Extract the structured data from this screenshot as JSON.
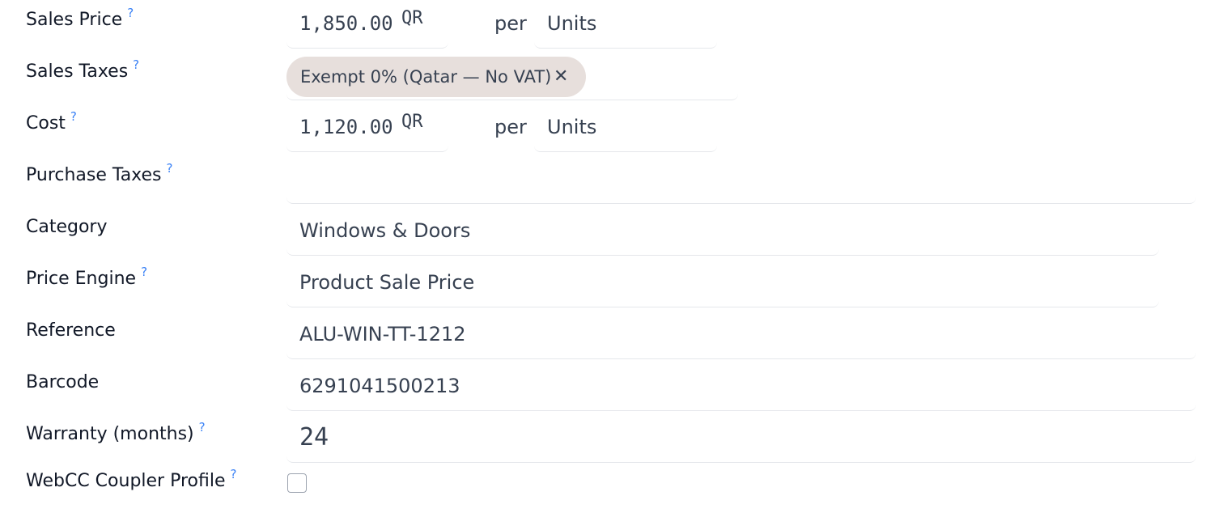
{
  "help_mark": "?",
  "sales_price": {
    "label": "Sales Price",
    "value": "1,850.00",
    "currency": "QR",
    "per": "per",
    "uom": "Units"
  },
  "sales_taxes": {
    "label": "Sales Taxes",
    "tags": [
      "Exempt 0% (Qatar — No VAT)"
    ],
    "remove_glyph": "✕"
  },
  "cost": {
    "label": "Cost",
    "value": "1,120.00",
    "currency": "QR",
    "per": "per",
    "uom": "Units"
  },
  "purchase_taxes": {
    "label": "Purchase Taxes",
    "value": ""
  },
  "category": {
    "label": "Category",
    "value": "Windows & Doors"
  },
  "price_engine": {
    "label": "Price Engine",
    "value": "Product Sale Price"
  },
  "reference": {
    "label": "Reference",
    "value": "ALU-WIN-TT-1212"
  },
  "barcode": {
    "label": "Barcode",
    "value": "6291041500213"
  },
  "warranty": {
    "label": "Warranty (months)",
    "value": "24"
  },
  "webcc": {
    "label": "WebCC Coupler Profile",
    "checked": false
  }
}
